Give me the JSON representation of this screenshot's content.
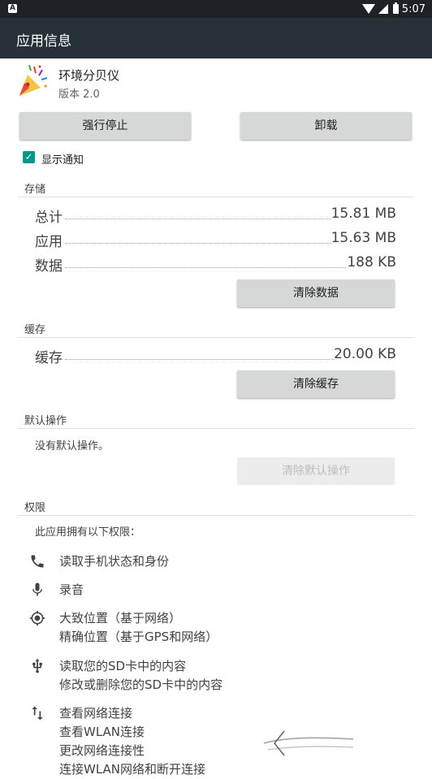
{
  "status_bar": {
    "time": "5:07",
    "notification_glyph": "A"
  },
  "app_bar": {
    "title": "应用信息"
  },
  "app": {
    "name": "环境分贝仪",
    "version": "版本 2.0"
  },
  "actions": {
    "force_stop": "强行停止",
    "uninstall": "卸载"
  },
  "notifications": {
    "label": "显示通知",
    "checked": true
  },
  "storage": {
    "title": "存储",
    "rows": [
      {
        "label": "总计",
        "value": "15.81 MB"
      },
      {
        "label": "应用",
        "value": "15.63 MB"
      },
      {
        "label": "数据",
        "value": "188 KB"
      }
    ],
    "clear_button": "清除数据"
  },
  "cache": {
    "title": "缓存",
    "rows": [
      {
        "label": "缓存",
        "value": "20.00 KB"
      }
    ],
    "clear_button": "清除缓存"
  },
  "defaults": {
    "title": "默认操作",
    "text": "没有默认操作。",
    "clear_button": "清除默认操作"
  },
  "permissions": {
    "title": "权限",
    "intro": "此应用拥有以下权限：",
    "groups": [
      {
        "icon": "phone-icon",
        "lines": [
          "读取手机状态和身份"
        ]
      },
      {
        "icon": "microphone-icon",
        "lines": [
          "录音"
        ]
      },
      {
        "icon": "location-icon",
        "lines": [
          "大致位置（基于网络）",
          "精确位置（基于GPS和网络）"
        ]
      },
      {
        "icon": "usb-icon",
        "lines": [
          "读取您的SD卡中的内容",
          "修改或删除您的SD卡中的内容"
        ]
      },
      {
        "icon": "network-arrows-icon",
        "lines": [
          "查看网络连接",
          "查看WLAN连接",
          "更改网络连接性",
          "连接WLAN网络和断开连接"
        ]
      }
    ]
  },
  "colors": {
    "app_bar": "#263238",
    "status_bar": "#1e2226",
    "checkbox": "#009688",
    "button": "#d6d7d7"
  }
}
